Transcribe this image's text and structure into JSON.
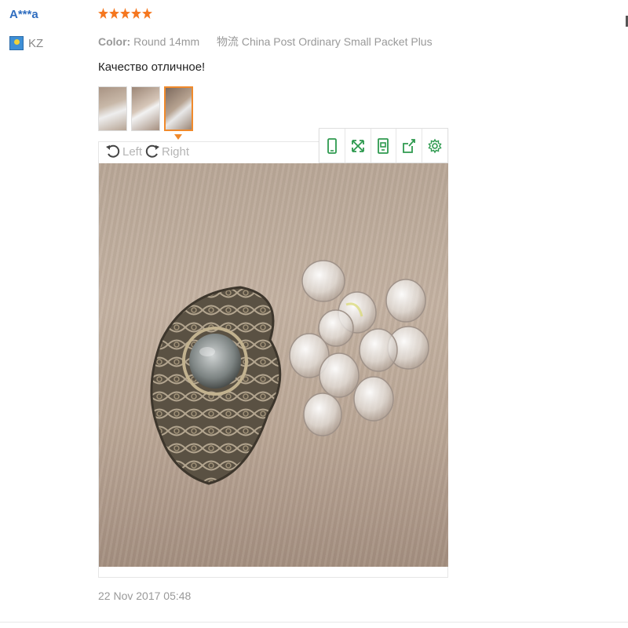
{
  "user": {
    "name": "A***a",
    "country": "KZ",
    "flag_icon": "kz-flag-icon"
  },
  "review": {
    "rating": 5,
    "rating_color": "#f5771f",
    "color_label": "Color:",
    "color_value": "Round 14mm",
    "shipping_label": "物流",
    "shipping_value": "China Post Ordinary Small Packet Plus",
    "text": "Качество отличное!",
    "thumbnails": [
      "photo-1",
      "photo-2",
      "photo-3"
    ],
    "selected_thumbnail": 3,
    "date": "22 Nov 2017 05:48"
  },
  "viewer": {
    "rotate_left_label": "Left",
    "rotate_right_label": "Right",
    "toolbar_icons": [
      "phone-icon",
      "fullscreen-icon",
      "save-icon",
      "share-icon",
      "settings-icon"
    ],
    "toolbar_icon_color": "#2e9a4f",
    "accent_color": "#f08a2c"
  }
}
